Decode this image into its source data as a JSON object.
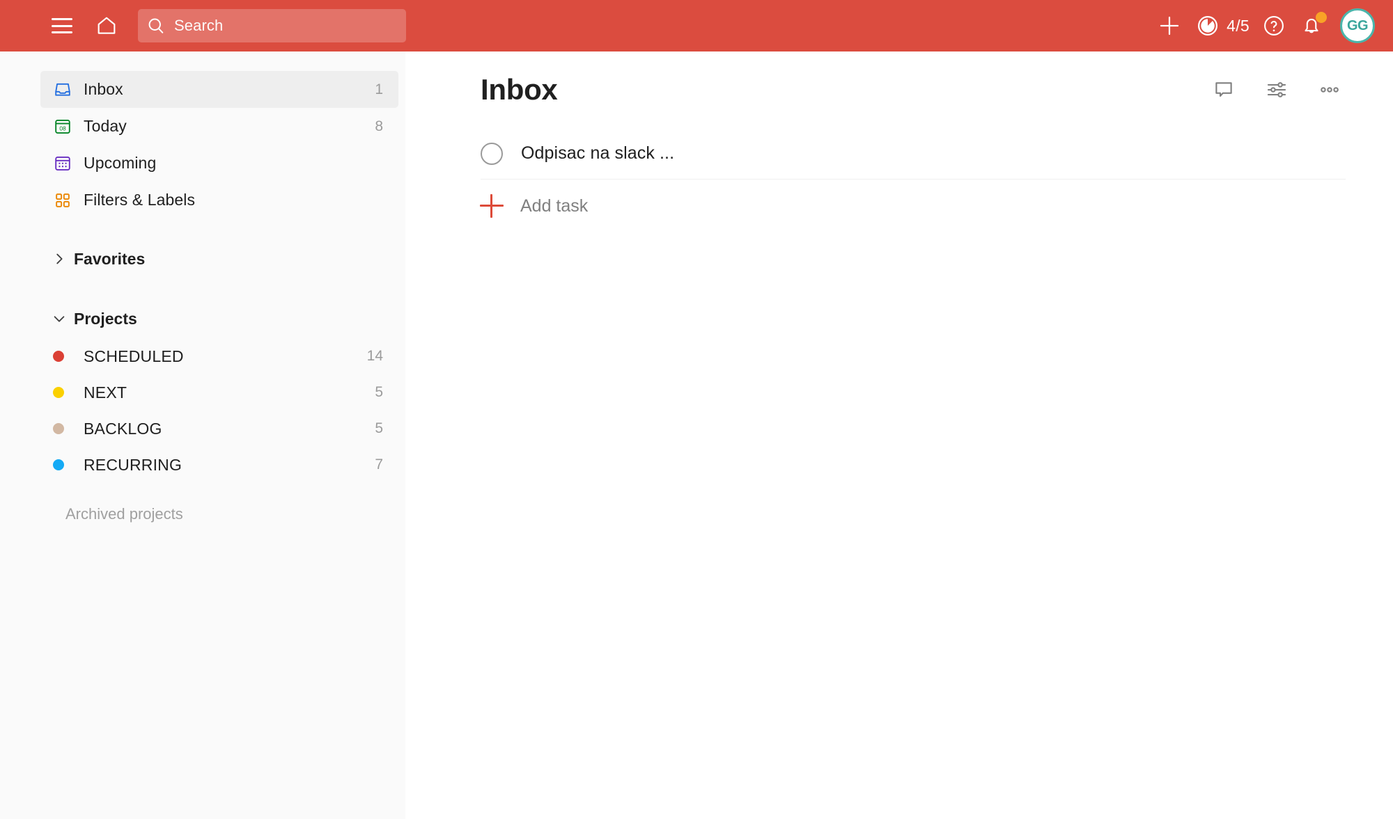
{
  "app": {
    "name": "Todoist",
    "brand_color": "#DB4C3F"
  },
  "topbar": {
    "menu_icon": "hamburger-menu-icon",
    "home_icon": "home-icon",
    "search": {
      "icon": "search-icon",
      "placeholder": "Search",
      "value": ""
    },
    "add_icon": "plus-icon",
    "karma": {
      "icon": "productivity-pie-icon",
      "label": "4/5",
      "completed": 4,
      "goal": 5
    },
    "help_icon": "question-mark-circle-icon",
    "notifications": {
      "icon": "bell-icon",
      "has_unread": true,
      "badge_color": "#F9A227"
    },
    "avatar": {
      "initials": "GG",
      "ring_color": "#4BB5AB",
      "text_color": "#3BA69C"
    }
  },
  "sidebar": {
    "nav_items": [
      {
        "label": "Inbox",
        "count": "1",
        "icon": "inbox-icon",
        "icon_color": "#246FE0",
        "active": true
      },
      {
        "label": "Today",
        "count": "8",
        "icon": "today-calendar-icon",
        "icon_color": "#058527",
        "day_number": "08",
        "active": false
      },
      {
        "label": "Upcoming",
        "count": "",
        "icon": "upcoming-calendar-icon",
        "icon_color": "#692FC2",
        "active": false
      },
      {
        "label": "Filters & Labels",
        "count": "",
        "icon": "filters-labels-grid-icon",
        "icon_color": "#EB8909",
        "active": false
      }
    ],
    "favorites": {
      "title": "Favorites",
      "expanded": false,
      "chevron": "chevron-right-icon"
    },
    "projects": {
      "title": "Projects",
      "expanded": true,
      "chevron": "chevron-down-icon",
      "items": [
        {
          "label": "SCHEDULED",
          "count": "14",
          "color": "#DB4035"
        },
        {
          "label": "NEXT",
          "count": "5",
          "color": "#FAD000"
        },
        {
          "label": "BACKLOG",
          "count": "5",
          "color": "#D2B8A3"
        },
        {
          "label": "RECURRING",
          "count": "7",
          "color": "#14AAF5"
        }
      ]
    },
    "archived_projects_label": "Archived projects"
  },
  "main": {
    "title": "Inbox",
    "actions": [
      {
        "name": "comments-button",
        "icon": "comment-bubble-icon"
      },
      {
        "name": "view-options-button",
        "icon": "sliders-icon"
      },
      {
        "name": "more-options-button",
        "icon": "three-dots-icon"
      }
    ],
    "tasks": [
      {
        "title": "Odpisac na slack ...",
        "completed": false
      }
    ],
    "add_task": {
      "label": "Add task",
      "icon": "plus-icon",
      "icon_color": "#DD4B39"
    }
  }
}
